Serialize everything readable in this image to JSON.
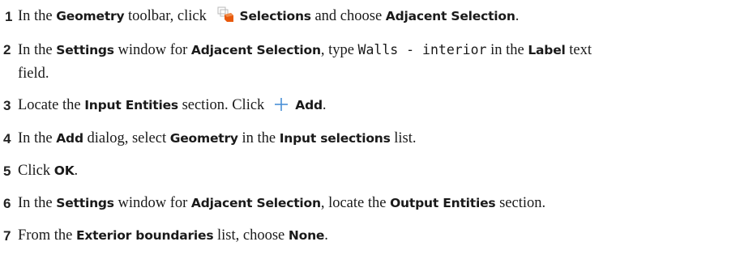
{
  "steps": [
    {
      "num": "1",
      "t1": "In the ",
      "b1": "Geometry",
      "t2": " toolbar, click ",
      "icon": "selections-icon",
      "b2": "Selections",
      "t3": " and choose ",
      "b3": "Adjacent Selection",
      "t4": "."
    },
    {
      "num": "2",
      "t1": "In the ",
      "b1": "Settings",
      "t2": " window for ",
      "b2": "Adjacent Selection",
      "t3": ", type ",
      "code": "Walls - interior",
      "t4": " in the ",
      "b3": "Label",
      "t5": " text",
      "t6": "field."
    },
    {
      "num": "3",
      "t1": "Locate the ",
      "b1": "Input Entities",
      "t2": " section. Click",
      "icon": "plus-icon",
      "b2": "Add",
      "t3": "."
    },
    {
      "num": "4",
      "t1": "In the ",
      "b1": "Add",
      "t2": " dialog, select ",
      "b2": "Geometry",
      "t3": " in the ",
      "b3": "Input selections",
      "t4": " list."
    },
    {
      "num": "5",
      "t1": "Click ",
      "b1": "OK",
      "t2": "."
    },
    {
      "num": "6",
      "t1": "In the ",
      "b1": "Settings",
      "t2": " window for ",
      "b2": "Adjacent Selection",
      "t3": ", locate the ",
      "b3": "Output Entities",
      "t4": " section."
    },
    {
      "num": "7",
      "t1": "From the ",
      "b1": "Exterior boundaries",
      "t2": " list, choose ",
      "b2": "None",
      "t3": "."
    }
  ],
  "colors": {
    "icon_orange": "#e8590c",
    "icon_gray": "#b8b8b8",
    "plus_blue": "#4a8fd6"
  }
}
